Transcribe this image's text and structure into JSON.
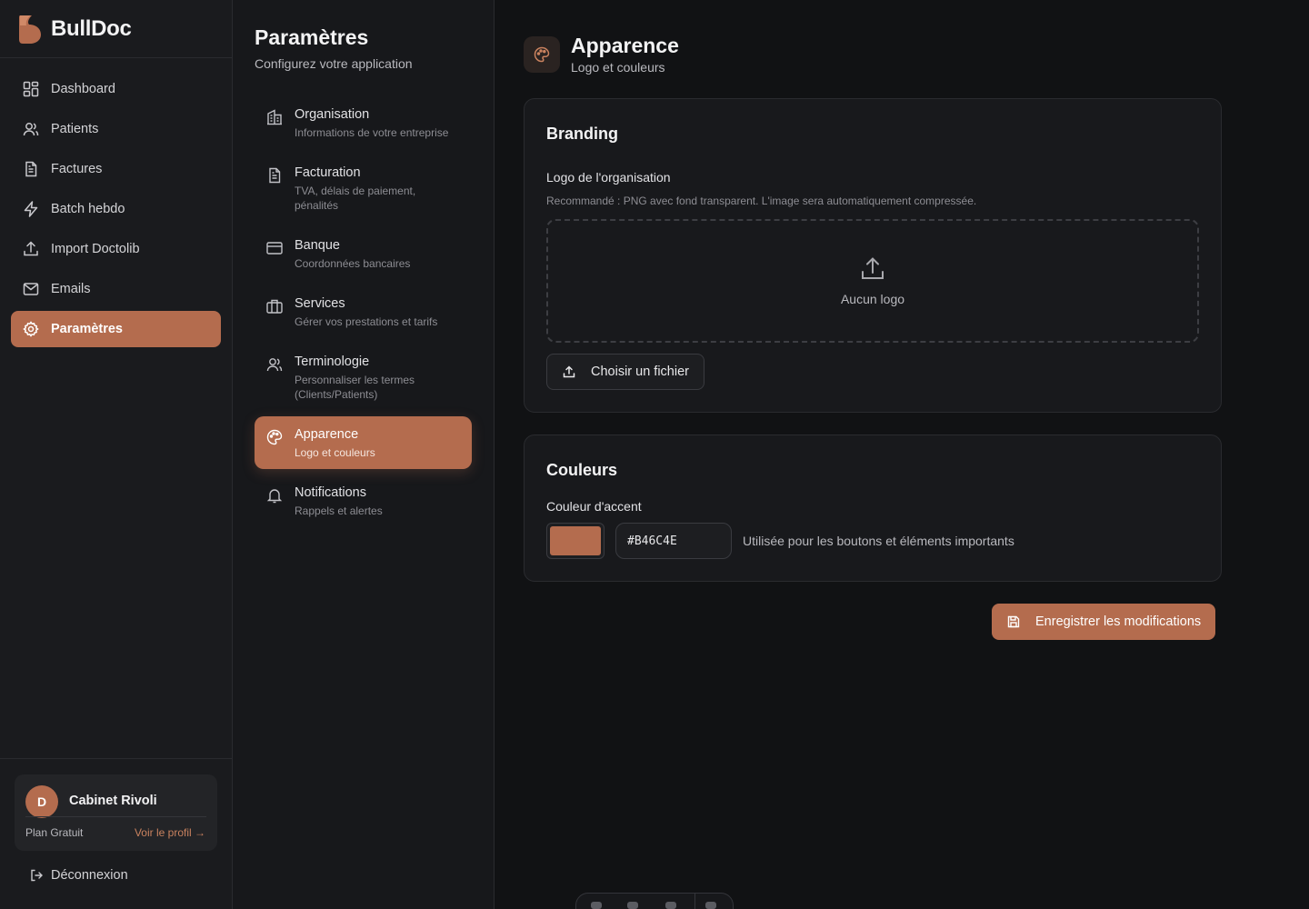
{
  "brand": {
    "name": "BullDoc",
    "accent": "#B46C4E"
  },
  "nav": {
    "items": [
      {
        "label": "Dashboard",
        "icon": "dashboard-icon",
        "active": false
      },
      {
        "label": "Patients",
        "icon": "users-icon",
        "active": false
      },
      {
        "label": "Factures",
        "icon": "file-text-icon",
        "active": false
      },
      {
        "label": "Batch hebdo",
        "icon": "lightning-icon",
        "active": false
      },
      {
        "label": "Import Doctolib",
        "icon": "upload-icon",
        "active": false
      },
      {
        "label": "Emails",
        "icon": "mail-icon",
        "active": false
      },
      {
        "label": "Paramètres",
        "icon": "gear-icon",
        "active": true
      }
    ]
  },
  "profile": {
    "initial": "D",
    "name": "Cabinet Rivoli",
    "plan": "Plan Gratuit",
    "view_profile": "Voir le profil →",
    "logout": "Déconnexion"
  },
  "settings": {
    "title": "Paramètres",
    "subtitle": "Configurez votre application",
    "items": [
      {
        "label": "Organisation",
        "desc": "Informations de votre entreprise",
        "icon": "building-icon",
        "active": false
      },
      {
        "label": "Facturation",
        "desc": "TVA, délais de paiement, pénalités",
        "icon": "file-text-icon",
        "active": false
      },
      {
        "label": "Banque",
        "desc": "Coordonnées bancaires",
        "icon": "credit-card-icon",
        "active": false
      },
      {
        "label": "Services",
        "desc": "Gérer vos prestations et tarifs",
        "icon": "briefcase-icon",
        "active": false
      },
      {
        "label": "Terminologie",
        "desc": "Personnaliser les termes (Clients/Patients)",
        "icon": "users-icon",
        "active": false
      },
      {
        "label": "Apparence",
        "desc": "Logo et couleurs",
        "icon": "palette-icon",
        "active": true
      },
      {
        "label": "Notifications",
        "desc": "Rappels et alertes",
        "icon": "bell-icon",
        "active": false
      }
    ]
  },
  "page": {
    "title": "Apparence",
    "subtitle": "Logo et couleurs",
    "icon": "palette-icon"
  },
  "branding": {
    "title": "Branding",
    "logo_label": "Logo de l'organisation",
    "logo_hint": "Recommandé : PNG avec fond transparent. L'image sera automatiquement compressée.",
    "dropzone_text": "Aucun logo",
    "choose_file": "Choisir un fichier"
  },
  "colors": {
    "title": "Couleurs",
    "accent_label": "Couleur d'accent",
    "accent_value": "#B46C4E",
    "accent_hint": "Utilisée pour les boutons et éléments importants"
  },
  "save_button": "Enregistrer les modifications"
}
